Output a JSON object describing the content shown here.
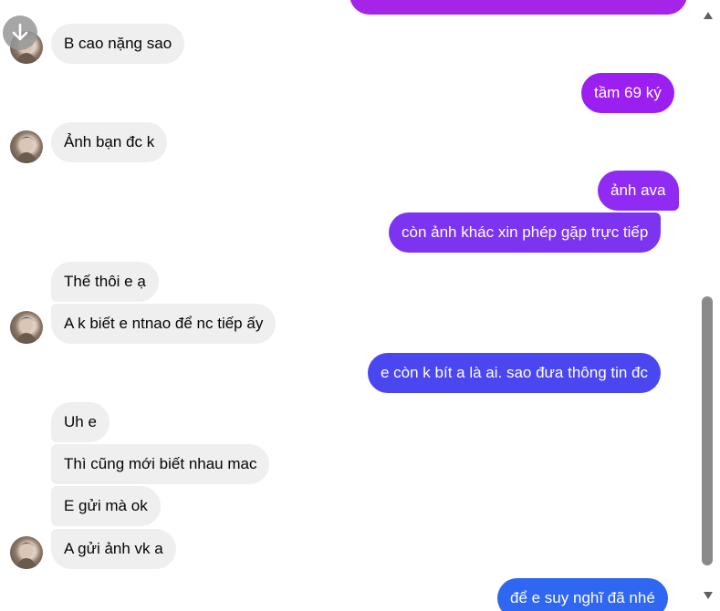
{
  "messages": [
    {
      "text": "",
      "side": "out",
      "color": "#a524e8"
    },
    {
      "text": "B cao nặng sao",
      "side": "in"
    },
    {
      "text": "tầm 69 ký",
      "side": "out",
      "color": "#9a1ff0"
    },
    {
      "text": "Ảnh bạn đc k",
      "side": "in"
    },
    {
      "text": "ảnh ava",
      "side": "out",
      "color": "#8f2bf2"
    },
    {
      "text": "còn ảnh khác xin phép gặp trực tiếp",
      "side": "out",
      "color": "#7c34f1"
    },
    {
      "text": "Thế thôi e ạ",
      "side": "in"
    },
    {
      "text": "A k biết e ntnao để nc tiếp ấy",
      "side": "in"
    },
    {
      "text": "e còn k bít a là ai. sao đưa thông tin đc",
      "side": "out",
      "color": "#4a46f0"
    },
    {
      "text": "Uh e",
      "side": "in"
    },
    {
      "text": "Thì cũng mới biết nhau mac",
      "side": "in"
    },
    {
      "text": "E gửi mà ok",
      "side": "in"
    },
    {
      "text": "A gửi ảnh vk a",
      "side": "in"
    },
    {
      "text": "để e suy nghĩ đã nhé",
      "side": "out",
      "color": "#2f66f2"
    }
  ],
  "scroll_down_icon": "arrow-down-icon",
  "scrollbar": {
    "thumb_position_fraction": 0.55,
    "up_icon": "triangle-up-icon",
    "down_icon": "triangle-down-icon"
  }
}
